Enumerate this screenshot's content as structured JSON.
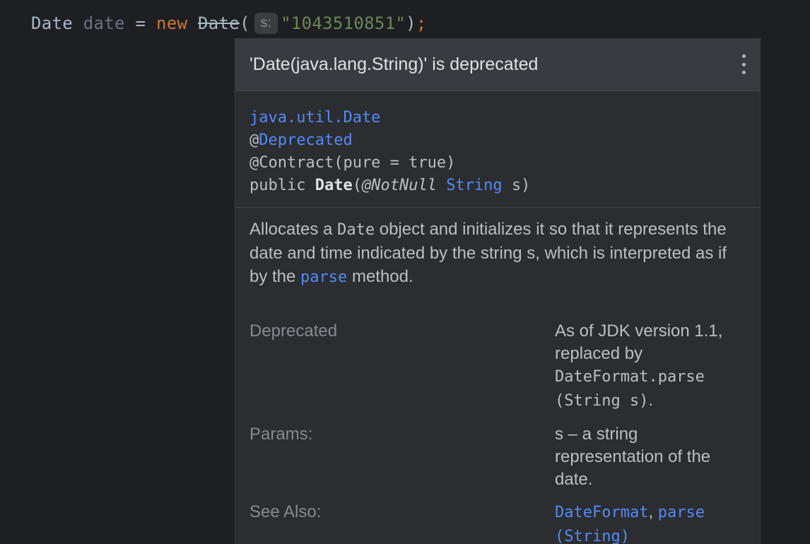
{
  "editor": {
    "code": {
      "type": "Date",
      "variable": "date",
      "assign": "=",
      "keyword": "new",
      "constructor": "Date",
      "open_paren": "(",
      "param_hint": "s:",
      "string_literal": "\"1043510851\"",
      "close_paren": ")",
      "semicolon": ";"
    }
  },
  "popup": {
    "title": "'Date(java.lang.String)' is deprecated",
    "menu_icon": "kebab-menu-icon",
    "signature": {
      "class_name": "java.util.Date",
      "annotation1_at": "@",
      "annotation1_name": "Deprecated",
      "annotation2": "@Contract(pure = true)",
      "modifier": "public",
      "method": "Date",
      "paren_open": "(",
      "param_annotation": "@NotNull",
      "param_type": "String",
      "param_name": "s)"
    },
    "description": {
      "part1": "Allocates a ",
      "code1": "Date",
      "part2": " object and initializes it so that it represents the date and time indicated by the string s, which is interpreted as if by the ",
      "link": "parse",
      "part3": " method."
    },
    "sections": {
      "deprecated_label": "Deprecated",
      "deprecated_text": "As of JDK version 1.1, replaced by ",
      "deprecated_code": "DateFormat.parse (String s)",
      "deprecated_end": ".",
      "params_label": "Params:",
      "params_text": "s – a string representation of the date.",
      "see_also_label": "See Also:",
      "see_also_link1": "DateFormat",
      "see_also_sep": ", ",
      "see_also_link2": "parse (String)"
    }
  },
  "colors": {
    "editor_bg": "#1e1f22",
    "popup_bg": "#2b2d30",
    "header_bg": "#393b40",
    "link": "#548af7",
    "keyword": "#cc7832",
    "string": "#6a8759"
  }
}
